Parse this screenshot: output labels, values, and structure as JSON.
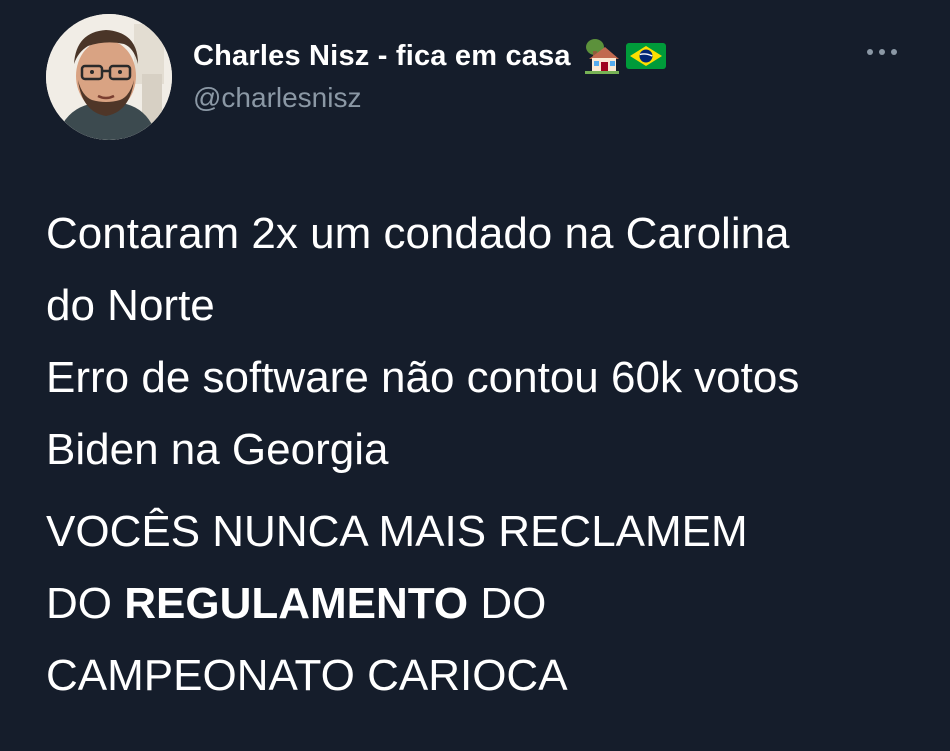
{
  "tweet": {
    "author": {
      "display_name": "Charles Nisz - fica em casa",
      "handle": "@charlesnisz",
      "name_emojis": [
        "house-with-garden-icon",
        "brazil-flag-icon"
      ],
      "avatar": "avatar"
    },
    "more_icon": "more-options-icon",
    "body": {
      "paragraph1": {
        "line1": "Contaram 2x um condado na Carolina",
        "line2": "do Norte",
        "line3": "Erro de software não contou 60k votos",
        "line4": "Biden na Georgia"
      },
      "paragraph2": {
        "line1": "VOCÊS NUNCA MAIS RECLAMEM",
        "line2_pre": "DO ",
        "line2_bold": "REGULAMENTO",
        "line2_post": " DO",
        "line3": "CAMPEONATO CARIOCA"
      }
    }
  },
  "colors": {
    "background": "#151d2b",
    "text": "#ffffff",
    "secondary_text": "#8b98a5"
  }
}
